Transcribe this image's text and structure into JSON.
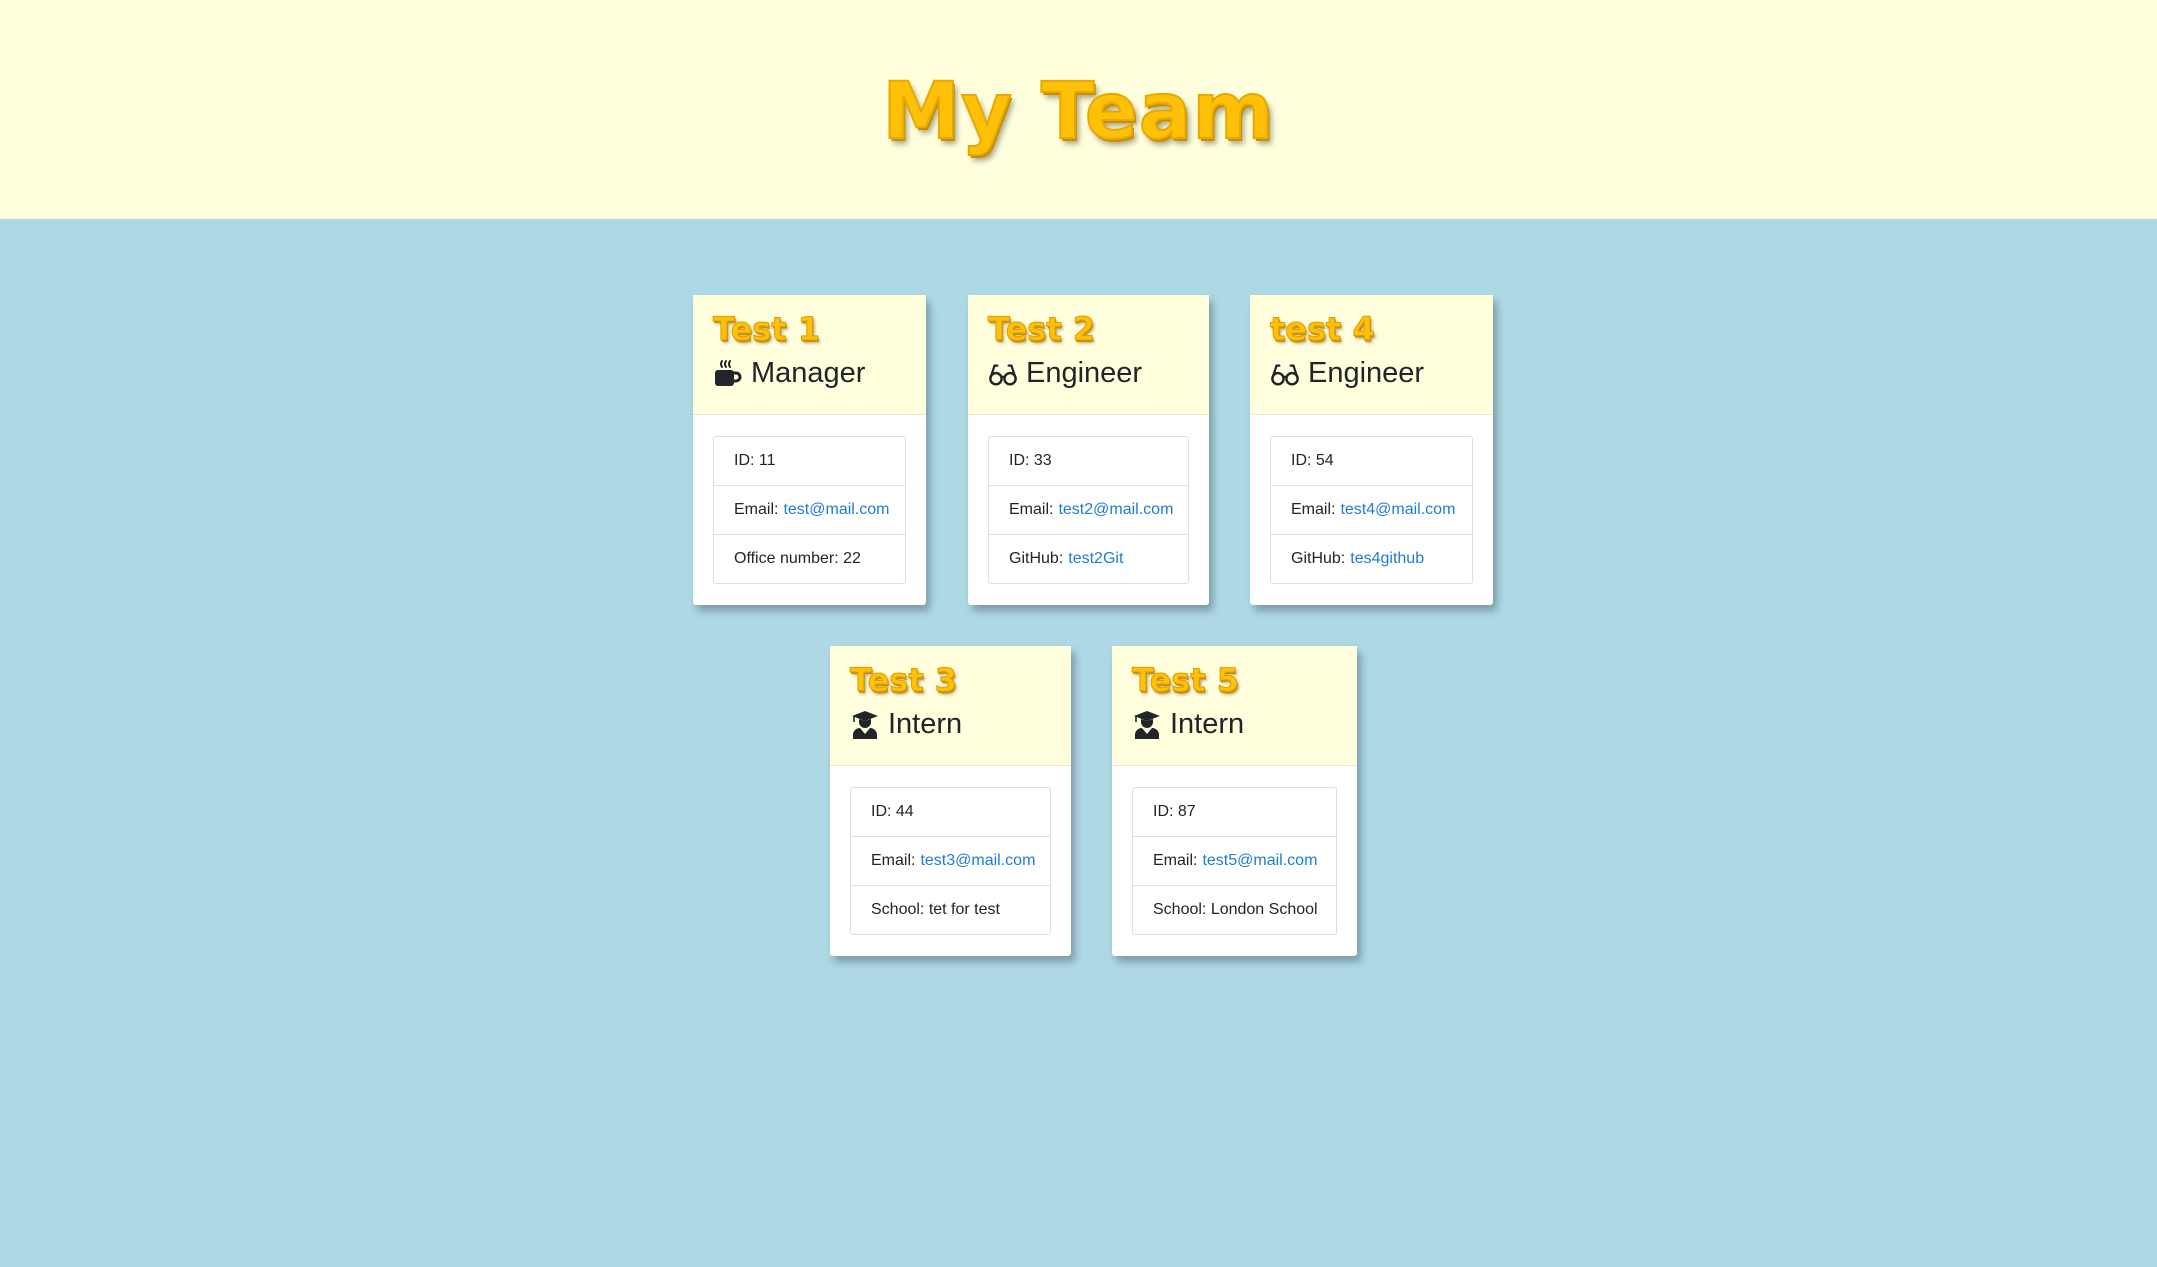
{
  "page": {
    "title": "My Team"
  },
  "colors": {
    "header_bg": "#ffffdd",
    "page_bg": "#add8e4",
    "name_color": "#ffc107",
    "link_color": "#1f7bd6"
  },
  "cards": [
    {
      "name": "Test 1",
      "role": "Manager",
      "icon": "mug-icon",
      "id_label": "ID: 11",
      "email_label": "Email:",
      "email": "test@mail.com",
      "extra_label": "Office number: 22",
      "extra_link": ""
    },
    {
      "name": "Test 2",
      "role": "Engineer",
      "icon": "glasses-icon",
      "id_label": "ID: 33",
      "email_label": "Email:",
      "email": "test2@mail.com",
      "extra_label": "GitHub:",
      "extra_link": "test2Git"
    },
    {
      "name": "test 4",
      "role": "Engineer",
      "icon": "glasses-icon",
      "id_label": "ID: 54",
      "email_label": "Email:",
      "email": "test4@mail.com",
      "extra_label": "GitHub:",
      "extra_link": "tes4github"
    },
    {
      "name": "Test 3",
      "role": "Intern",
      "icon": "graduate-icon",
      "id_label": "ID: 44",
      "email_label": "Email:",
      "email": "test3@mail.com",
      "extra_label": "School: tet for test",
      "extra_link": ""
    },
    {
      "name": "Test 5",
      "role": "Intern",
      "icon": "graduate-icon",
      "id_label": "ID: 87",
      "email_label": "Email:",
      "email": "test5@mail.com",
      "extra_label": "School: London School",
      "extra_link": ""
    }
  ]
}
